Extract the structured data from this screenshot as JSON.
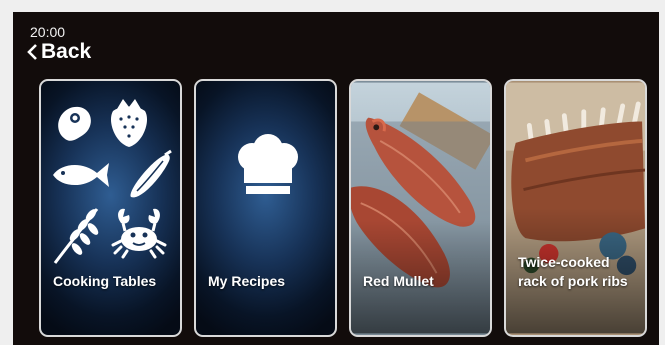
{
  "status": {
    "time": "20:00"
  },
  "nav": {
    "back_label": "Back",
    "back_icon": "chevron-left-icon"
  },
  "cards": [
    {
      "label": "Cooking Tables",
      "icons": [
        "steak-icon",
        "strawberry-icon",
        "fish-icon",
        "zucchini-icon",
        "wheat-icon",
        "crab-icon"
      ]
    },
    {
      "label": "My Recipes",
      "icon": "chef-hat-icon"
    },
    {
      "label": "Red Mullet",
      "image": "red-mullet-photo"
    },
    {
      "label_line1": "Twice-cooked",
      "label_line2": "rack of pork ribs",
      "image": "pork-ribs-photo"
    }
  ],
  "colors": {
    "screen_bg": "#120c0b",
    "card_border": "#d9d9d9",
    "card_blue": "#173257"
  }
}
